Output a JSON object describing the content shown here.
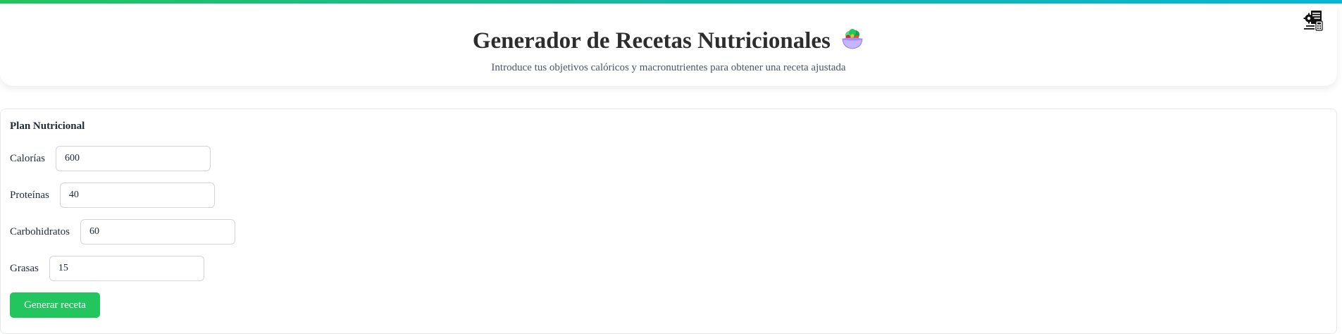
{
  "header": {
    "title": "Generador de Recetas Nutricionales",
    "title_icon": "salad-bowl-icon",
    "subtitle": "Introduce tus objetivos calóricos y macronutrientes para obtener una receta ajustada",
    "settings_icon": "settings-document-icon"
  },
  "colors": {
    "accent_gradient": [
      "#22c55e",
      "#14b8a6",
      "#06b6d4"
    ],
    "button": "#22c55e"
  },
  "plan": {
    "title": "Plan Nutricional",
    "fields": [
      {
        "label": "Calorías",
        "value": "600"
      },
      {
        "label": "Proteínas",
        "value": "40"
      },
      {
        "label": "Carbohidratos",
        "value": "60"
      },
      {
        "label": "Grasas",
        "value": "15"
      }
    ],
    "generate_label": "Generar receta"
  }
}
